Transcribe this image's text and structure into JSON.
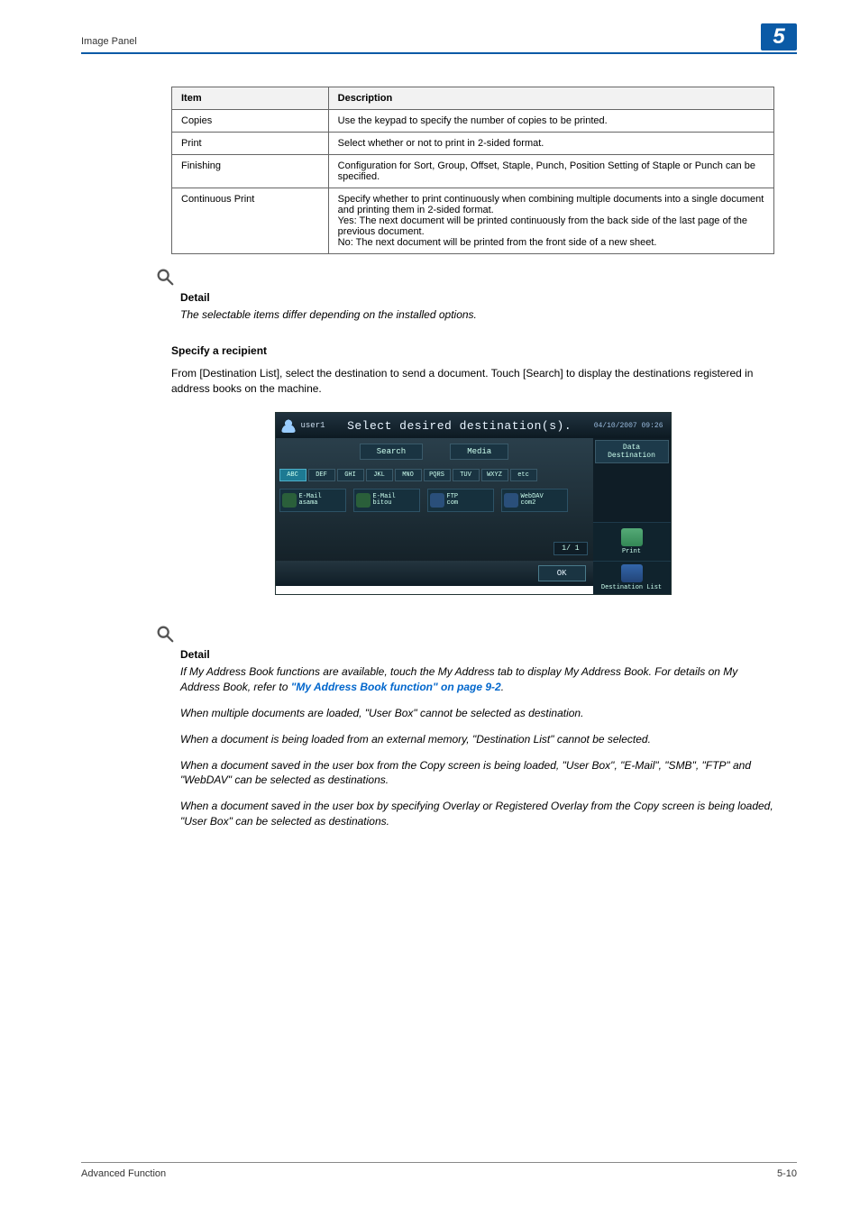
{
  "header": {
    "section": "Image Panel",
    "chapter": "5"
  },
  "table": {
    "headers": {
      "item": "Item",
      "desc": "Description"
    },
    "rows": [
      {
        "item": "Copies",
        "desc": "Use the keypad to specify the number of copies to be printed."
      },
      {
        "item": "Print",
        "desc": "Select whether or not to print in 2-sided format."
      },
      {
        "item": "Finishing",
        "desc": "Configuration for Sort, Group, Offset, Staple, Punch, Position Setting of Staple or Punch can be specified."
      },
      {
        "item": "Continuous Print",
        "desc": "Specify whether to print continuously when combining multiple documents into a single document and printing them in 2-sided format.\nYes: The next document will be printed continuously from the back side of the last page of the previous document.\nNo: The next document will be printed from the front side of a new sheet."
      }
    ]
  },
  "detail1": {
    "title": "Detail",
    "text": "The selectable items differ depending on the installed options."
  },
  "section2": {
    "heading": "Specify a recipient",
    "body": "From [Destination List], select the destination to send a document. Touch [Search] to display the destinations registered in address books on the machine."
  },
  "ui": {
    "user": "user1",
    "title": "Select desired destination(s).",
    "time": "04/10/2007  09:26",
    "sideTop": "Data Destination",
    "search": "Search",
    "media": "Media",
    "tabs": [
      "ABC",
      "DEF",
      "GHI",
      "JKL",
      "MNO",
      "PQRS",
      "TUV",
      "WXYZ",
      "etc"
    ],
    "cards": [
      {
        "type": "E-Mail",
        "name": "asama"
      },
      {
        "type": "E-Mail",
        "name": "bitou"
      },
      {
        "type": "FTP",
        "name": "com"
      },
      {
        "type": "WebDAV",
        "name": "com2"
      }
    ],
    "pager": "1/  1",
    "print": "Print",
    "destlist": "Destination List",
    "ok": "OK"
  },
  "detail2": {
    "title": "Detail",
    "p1a": "If My Address Book functions are available, touch the My Address tab to display My Address Book. For details on My Address Book, refer to ",
    "p1link": "\"My Address Book function\" on page 9-2",
    "p1b": ".",
    "p2": "When multiple documents are loaded, \"User Box\" cannot be selected as destination.",
    "p3": "When a document is being loaded from an external memory, \"Destination List\" cannot be selected.",
    "p4": "When a document saved in the user box from the Copy screen is being loaded, \"User Box\",  \"E-Mail\", \"SMB\", \"FTP\" and \"WebDAV\" can be selected as destinations.",
    "p5": "When a document saved in the user box by specifying Overlay or Registered Overlay from the Copy screen is being loaded, \"User Box\" can be selected as destinations."
  },
  "footer": {
    "left": "Advanced Function",
    "right": "5-10"
  }
}
